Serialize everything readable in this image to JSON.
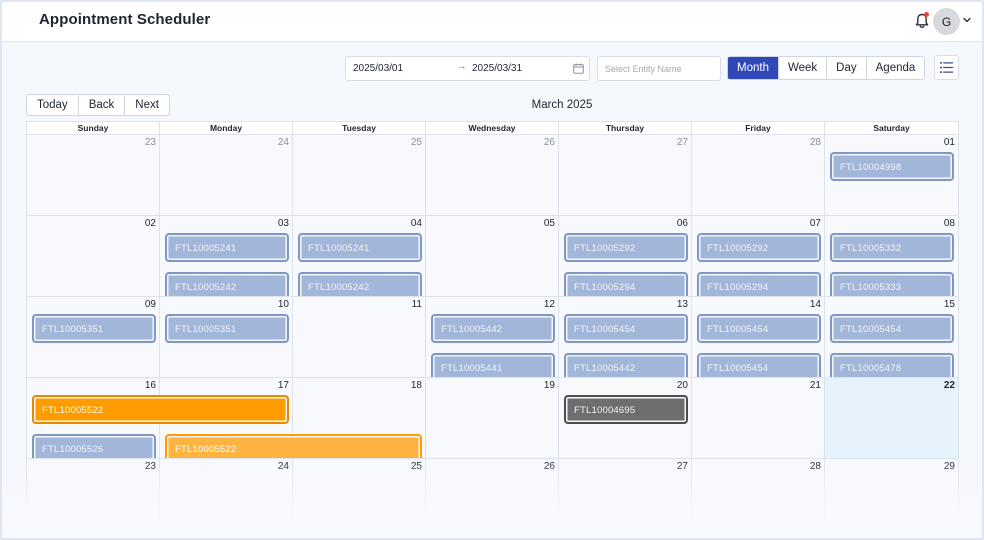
{
  "header": {
    "title": "Appointment Scheduler",
    "avatar_initial": "G",
    "icons": [
      "bell-icon",
      "chevron-down-icon"
    ],
    "notification_dot_color": "#e8463d"
  },
  "toolbar": {
    "date_start": "2025/03/01",
    "date_separator": "→",
    "date_end": "2025/03/31",
    "entity_placeholder": "Select Entity Name",
    "views": [
      "Month",
      "Week",
      "Day",
      "Agenda"
    ],
    "active_view": "Month",
    "accent_color": "#2f47b8"
  },
  "nav": {
    "today": "Today",
    "back": "Back",
    "next": "Next",
    "month_label": "March 2025"
  },
  "calendar": {
    "days_of_week": [
      "Sunday",
      "Monday",
      "Tuesday",
      "Wednesday",
      "Thursday",
      "Friday",
      "Saturday"
    ],
    "weeks": [
      {
        "days": [
          {
            "num": "23",
            "off": true,
            "events": []
          },
          {
            "num": "24",
            "off": true,
            "events": []
          },
          {
            "num": "25",
            "off": true,
            "events": []
          },
          {
            "num": "26",
            "off": true,
            "events": []
          },
          {
            "num": "27",
            "off": true,
            "events": []
          },
          {
            "num": "28",
            "off": true,
            "events": []
          },
          {
            "num": "01",
            "events": [
              "FTL10004998"
            ]
          }
        ]
      },
      {
        "days": [
          {
            "num": "02",
            "events": []
          },
          {
            "num": "03",
            "events": [
              "FTL10005241",
              "FTL10005242"
            ]
          },
          {
            "num": "04",
            "events": [
              "FTL10005241",
              "FTL10005242"
            ]
          },
          {
            "num": "05",
            "events": []
          },
          {
            "num": "06",
            "events": [
              "FTL10005292",
              "FTL10005294"
            ]
          },
          {
            "num": "07",
            "events": [
              "FTL10005292",
              "FTL10005294"
            ]
          },
          {
            "num": "08",
            "events": [
              "FTL10005332",
              "FTL10005333"
            ]
          }
        ]
      },
      {
        "days": [
          {
            "num": "09",
            "events": [
              "FTL10005351"
            ]
          },
          {
            "num": "10",
            "events": [
              "FTL10005351"
            ]
          },
          {
            "num": "11",
            "events": []
          },
          {
            "num": "12",
            "events": [
              "FTL10005442",
              "FTL10005441"
            ]
          },
          {
            "num": "13",
            "events": [
              "FTL10005454",
              "FTL10005442"
            ]
          },
          {
            "num": "14",
            "events": [
              "FTL10005454",
              "FTL10005454"
            ]
          },
          {
            "num": "15",
            "events": [
              "FTL10005454",
              "FTL10005478"
            ]
          }
        ]
      },
      {
        "days": [
          {
            "num": "16",
            "events": []
          },
          {
            "num": "17",
            "events": []
          },
          {
            "num": "18",
            "events": []
          },
          {
            "num": "19",
            "events": []
          },
          {
            "num": "20",
            "events": []
          },
          {
            "num": "21",
            "events": []
          },
          {
            "num": "22",
            "today": true,
            "events": []
          }
        ],
        "spanning": [
          {
            "label": "FTL10005522",
            "start": 0,
            "span": 2,
            "row": 0,
            "style": "orange"
          },
          {
            "label": "FTL10004695",
            "start": 4,
            "span": 1,
            "row": 0,
            "style": "gray"
          },
          {
            "label": "FTL10005526",
            "start": 0,
            "span": 1,
            "row": 1,
            "style": "blue"
          },
          {
            "label": "FTL10005522",
            "start": 1,
            "span": 2,
            "row": 1,
            "style": "orange-light"
          }
        ]
      },
      {
        "days": [
          {
            "num": "23",
            "events": []
          },
          {
            "num": "24",
            "events": []
          },
          {
            "num": "25",
            "events": []
          },
          {
            "num": "26",
            "events": []
          },
          {
            "num": "27",
            "events": []
          },
          {
            "num": "28",
            "events": []
          },
          {
            "num": "29",
            "events": []
          }
        ]
      }
    ],
    "event_color": "#a1b6d9",
    "today_color": "#e6f2fc"
  }
}
